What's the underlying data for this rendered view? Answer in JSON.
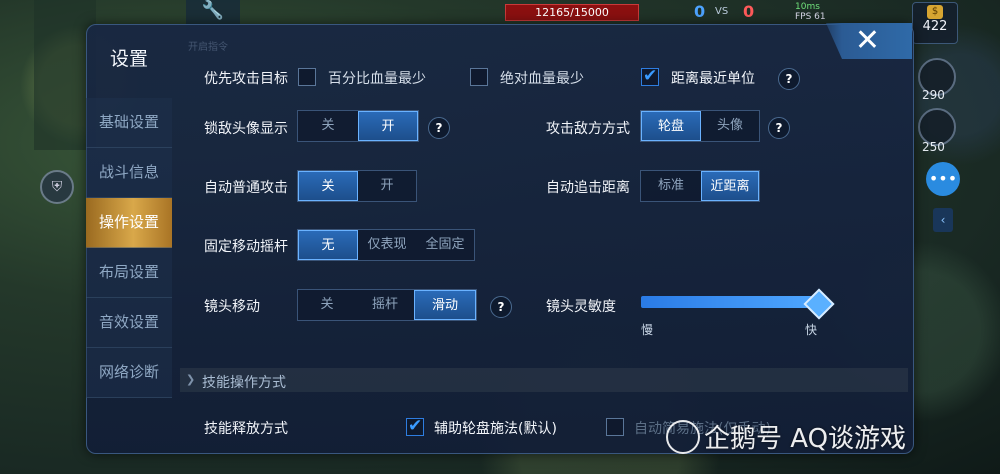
{
  "hud": {
    "hp": "12165/15000",
    "score_blue": "0",
    "vs": "VS",
    "score_red": "0",
    "ping": "10ms",
    "fps": "FPS 61",
    "gold": "422",
    "skills": [
      "290",
      "250"
    ]
  },
  "panel": {
    "title": "设置",
    "close_icon": "close-icon",
    "faded_header": "开启指令"
  },
  "sidebar": {
    "items": [
      {
        "label": "基础设置",
        "active": false
      },
      {
        "label": "战斗信息",
        "active": false
      },
      {
        "label": "操作设置",
        "active": true
      },
      {
        "label": "布局设置",
        "active": false
      },
      {
        "label": "音效设置",
        "active": false
      },
      {
        "label": "网络诊断",
        "active": false
      }
    ]
  },
  "settings": {
    "priority_target": {
      "label": "优先攻击目标",
      "options": [
        {
          "label": "百分比血量最少",
          "checked": false
        },
        {
          "label": "绝对血量最少",
          "checked": false
        },
        {
          "label": "距离最近单位",
          "checked": true
        }
      ],
      "help": "?"
    },
    "lock_avatar": {
      "label": "锁敌头像显示",
      "options": [
        "关",
        "开"
      ],
      "selected": "开",
      "help": "?"
    },
    "attack_enemy_mode": {
      "label": "攻击敌方方式",
      "options": [
        "轮盘",
        "头像"
      ],
      "selected": "轮盘",
      "help": "?"
    },
    "auto_attack": {
      "label": "自动普通攻击",
      "options": [
        "关",
        "开"
      ],
      "selected": "关"
    },
    "auto_chase": {
      "label": "自动追击距离",
      "options": [
        "标准",
        "近距离"
      ],
      "selected": "近距离"
    },
    "fixed_joystick": {
      "label": "固定移动摇杆",
      "options": [
        "无",
        "仅表现",
        "全固定"
      ],
      "selected": "无"
    },
    "camera_move": {
      "label": "镜头移动",
      "options": [
        "关",
        "摇杆",
        "滑动"
      ],
      "selected": "滑动",
      "help": "?"
    },
    "camera_sensitivity": {
      "label": "镜头灵敏度",
      "min_label": "慢",
      "max_label": "快",
      "value": 1.0
    }
  },
  "skill_section": {
    "title": "技能操作方式",
    "release_mode": {
      "label": "技能释放方式",
      "options": [
        {
          "label": "辅助轮盘施法(默认)",
          "checked": true
        },
        {
          "label": "自动简易施法(仅手动)",
          "checked": false
        }
      ]
    }
  },
  "watermark": "企鹅号 AQ谈游戏",
  "colors": {
    "accent": "#2a6bb8",
    "active_tab": "#d9a84a",
    "panel_bg": "#182742"
  }
}
